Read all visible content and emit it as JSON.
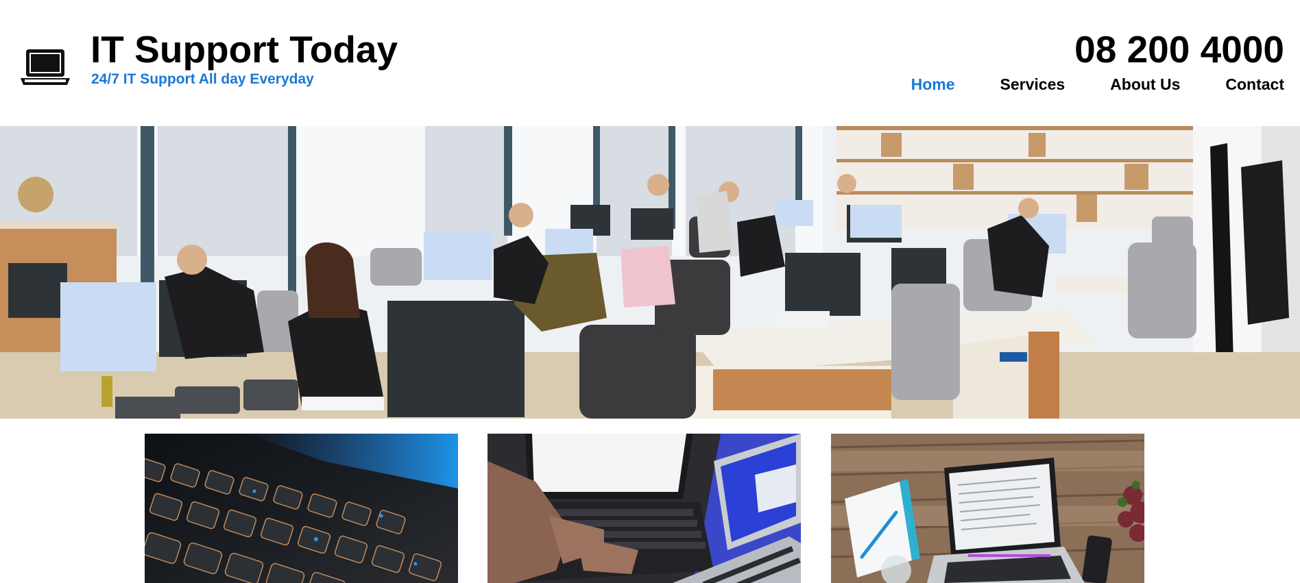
{
  "header": {
    "title": "IT Support Today",
    "tagline": "24/7 IT Support All day Everyday",
    "phone": "08 200 4000",
    "logo_icon": "laptop-icon"
  },
  "nav": {
    "items": [
      {
        "label": "Home",
        "active": true
      },
      {
        "label": "Services",
        "active": false
      },
      {
        "label": "About Us",
        "active": false
      },
      {
        "label": "Contact",
        "active": false
      }
    ]
  },
  "colors": {
    "accent": "#1a78d6",
    "text": "#000000",
    "background": "#ffffff"
  },
  "hero": {
    "image": "office-workspace-photo"
  },
  "cards": [
    {
      "image": "backlit-keyboard-photo"
    },
    {
      "image": "laptop-typing-photo"
    },
    {
      "image": "laptop-on-wooden-desk-photo"
    }
  ]
}
